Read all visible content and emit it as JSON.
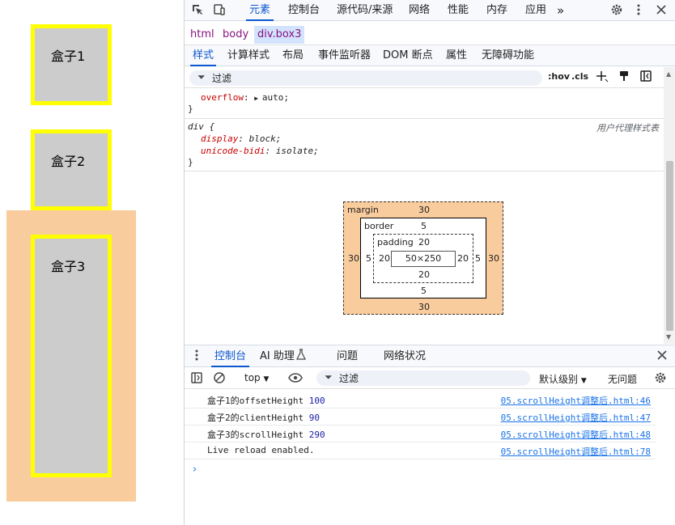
{
  "page": {
    "box1_label": "盒子1",
    "box2_label": "盒子2",
    "box3_label": "盒子3"
  },
  "toolbar": {
    "tabs": [
      "元素",
      "控制台",
      "源代码/来源",
      "网络",
      "性能",
      "内存",
      "应用"
    ],
    "more": "»"
  },
  "breadcrumbs": [
    "html",
    "body",
    "div.box3"
  ],
  "subtabs": [
    "样式",
    "计算样式",
    "布局",
    "事件监听器",
    "DOM 断点",
    "属性",
    "无障碍功能"
  ],
  "styles_filter": {
    "placeholder": "过滤",
    "hov": ":hov",
    "cls": ".cls"
  },
  "styles": {
    "overflow_prop": "overflow",
    "overflow_val": "auto;",
    "close_brace": "}",
    "ua_selector": "div {",
    "ua_label": "用户代理样式表",
    "display_prop": "display",
    "display_val": "block;",
    "unicode_prop": "unicode-bidi",
    "unicode_val": "isolate;"
  },
  "box_model": {
    "margin_label": "margin",
    "margin_top": "30",
    "margin_left": "30",
    "margin_right": "30",
    "margin_bottom": "30",
    "border_label": "border",
    "border_top": "5",
    "border_left": "5",
    "border_right": "5",
    "border_bottom": "5",
    "padding_label": "padding",
    "padding_top": "20",
    "padding_left": "20",
    "padding_right": "20",
    "padding_bottom": "20",
    "content": "50×250"
  },
  "drawer": {
    "tabs": [
      "控制台",
      "AI 助理",
      "问题",
      "网络状况"
    ]
  },
  "console_toolbar": {
    "context": "top",
    "filter_placeholder": "过滤",
    "levels": "默认级别",
    "issues": "无问题"
  },
  "console": {
    "messages": [
      {
        "text": "盒子1的offsetHeight",
        "value": "100",
        "source": "05.scrollHeight调整后.html:46"
      },
      {
        "text": "盒子2的clientHeight",
        "value": "90",
        "source": "05.scrollHeight调整后.html:47"
      },
      {
        "text": "盒子3的scrollHeight",
        "value": "290",
        "source": "05.scrollHeight调整后.html:48"
      },
      {
        "text": "Live reload enabled.",
        "value": "",
        "source": "05.scrollHeight调整后.html:78"
      }
    ],
    "prompt": "›"
  },
  "colors": {
    "accent": "#0b57d0",
    "box_bg": "#cccccc",
    "box_border": "#ffff00",
    "margin_highlight": "#f9cc9d"
  }
}
